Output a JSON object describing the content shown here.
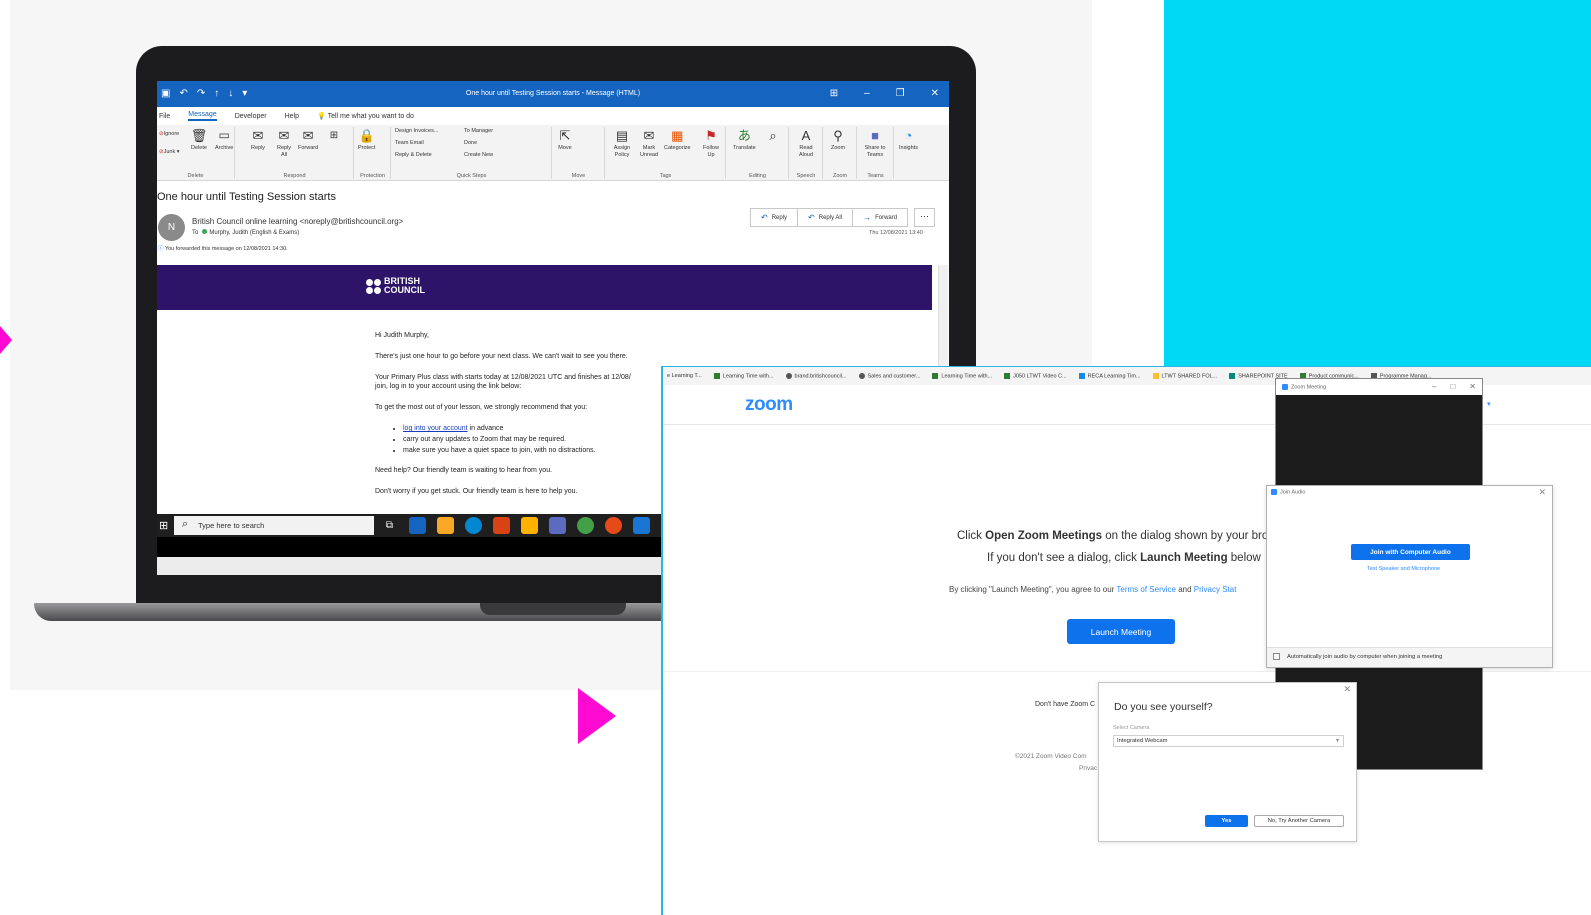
{
  "colors": {
    "cyan_panel": "#00d9f5",
    "pink_marker": "#ff0ad2",
    "outlook_blue": "#1565c0",
    "british_council_purple": "#2d1468",
    "zoom_blue": "#0e72ed"
  },
  "outlook": {
    "window_title": "One hour until Testing Session starts  -  Message (HTML)",
    "menu": [
      {
        "label": "File"
      },
      {
        "label": "Message"
      },
      {
        "label": "Developer"
      },
      {
        "label": "Help"
      },
      {
        "label": "Tell me what you want to do",
        "icon": "lightbulb-icon"
      }
    ],
    "ribbon": {
      "groups": {
        "delete": "Delete",
        "respond": "Respond",
        "protection": "Protection",
        "quick_steps": "Quick Steps",
        "move": "Move",
        "tags": "Tags",
        "editing": "Editing",
        "speech": "Speech",
        "zoom": "Zoom",
        "teams": "Teams"
      },
      "buttons": {
        "ignore": "Ignore",
        "junk": "Junk",
        "delete": "Delete",
        "archive": "Archive",
        "reply": "Reply",
        "reply_all": "Reply All",
        "forward": "Forward",
        "protect": "Protect",
        "move": "Move",
        "assign_policy": "Assign Policy",
        "mark_unread": "Mark Unread",
        "categorize": "Categorize",
        "follow_up": "Follow Up",
        "translate": "Translate",
        "read_aloud": "Read Aloud",
        "zoom": "Zoom",
        "share_to_teams": "Share to Teams",
        "insights": "Insights"
      },
      "quick_steps": [
        "Design Invoices...",
        "To Manager",
        "Team Email",
        "Done",
        "Reply & Delete",
        "Create New"
      ]
    },
    "subject": "One hour until Testing Session starts",
    "avatar_initial": "N",
    "from": "British Council online learning <noreply@britishcouncil.org>",
    "to_label": "To",
    "to": "Murphy, Judith (English & Exams)",
    "forwarded_note": "You forwarded this message on 12/08/2021 14:30.",
    "actions": {
      "reply": "Reply",
      "reply_all": "Reply All",
      "forward": "Forward",
      "more": "···"
    },
    "date": "Thu 12/08/2021 13:40",
    "banner_logo_line1": "BRITISH",
    "banner_logo_line2": "COUNCIL",
    "body": {
      "greeting": "Hi Judith Murphy,",
      "p1": "There's just one hour to go before your next class. We can't wait to see you there.",
      "p2": "Your Primary Plus class with starts today at 12/08/2021 UTC and finishes at 12/08/",
      "p2b": "join, log in to your account using the link below:",
      "p3": "To get the most out of your lesson, we strongly recommend that you:",
      "bullets": [
        {
          "link": "log into your account",
          "rest": " in advance"
        },
        {
          "link": "",
          "rest": "carry out any updates to Zoom that may be required."
        },
        {
          "link": "",
          "rest": "make sure you have a quiet space to join, with no distractions."
        }
      ],
      "p4": "Need help? Our friendly team is waiting to hear from you.",
      "p5": "Don't worry if you get stuck. Our friendly team is here to help you."
    },
    "taskbar_search": "Type here to search"
  },
  "browser": {
    "bookmarks": [
      "e Learning T...",
      "Learning Time with...",
      "brand.britishcouncil...",
      "Sales and customer...",
      "Learning Time with...",
      "J050 LTWT Video C...",
      "RECA Learning Tim...",
      "LTWT SHARED FOL...",
      "SHAREPOINT SITE",
      "Product communic...",
      "Programme Manag..."
    ]
  },
  "zoom_page": {
    "logo": "zoom",
    "line1_a": "Click ",
    "line1_b": "Open Zoom Meetings",
    "line1_c": " on the dialog shown by your brow",
    "line2_a": "If you don't see a dialog, click ",
    "line2_b": "Launch Meeting",
    "line2_c": " below",
    "line3_a": "By clicking \"Launch Meeting\", you agree to our ",
    "line3_terms": "Terms of Service",
    "line3_and": " and ",
    "line3_privacy": "Privacy Stat",
    "launch_button": "Launch Meeting",
    "dont_have": "Don't have Zoom C",
    "copyright": "©2021 Zoom Video Com",
    "privacy": "Privac"
  },
  "zoom_meeting": {
    "title": "Zoom Meeting",
    "controls": [
      "–",
      "□",
      "✕"
    ]
  },
  "join_audio": {
    "title": "Join Audio",
    "join_button": "Join with Computer Audio",
    "test_link": "Test Speaker and Microphone",
    "auto_join": "Automatically join audio by computer when joining a meeting"
  },
  "camera_dialog": {
    "title": "Do you see yourself?",
    "select_label": "Select Camera",
    "selected_camera": "Integrated Webcam",
    "yes": "Yes",
    "no": "No, Try Another Camera"
  }
}
